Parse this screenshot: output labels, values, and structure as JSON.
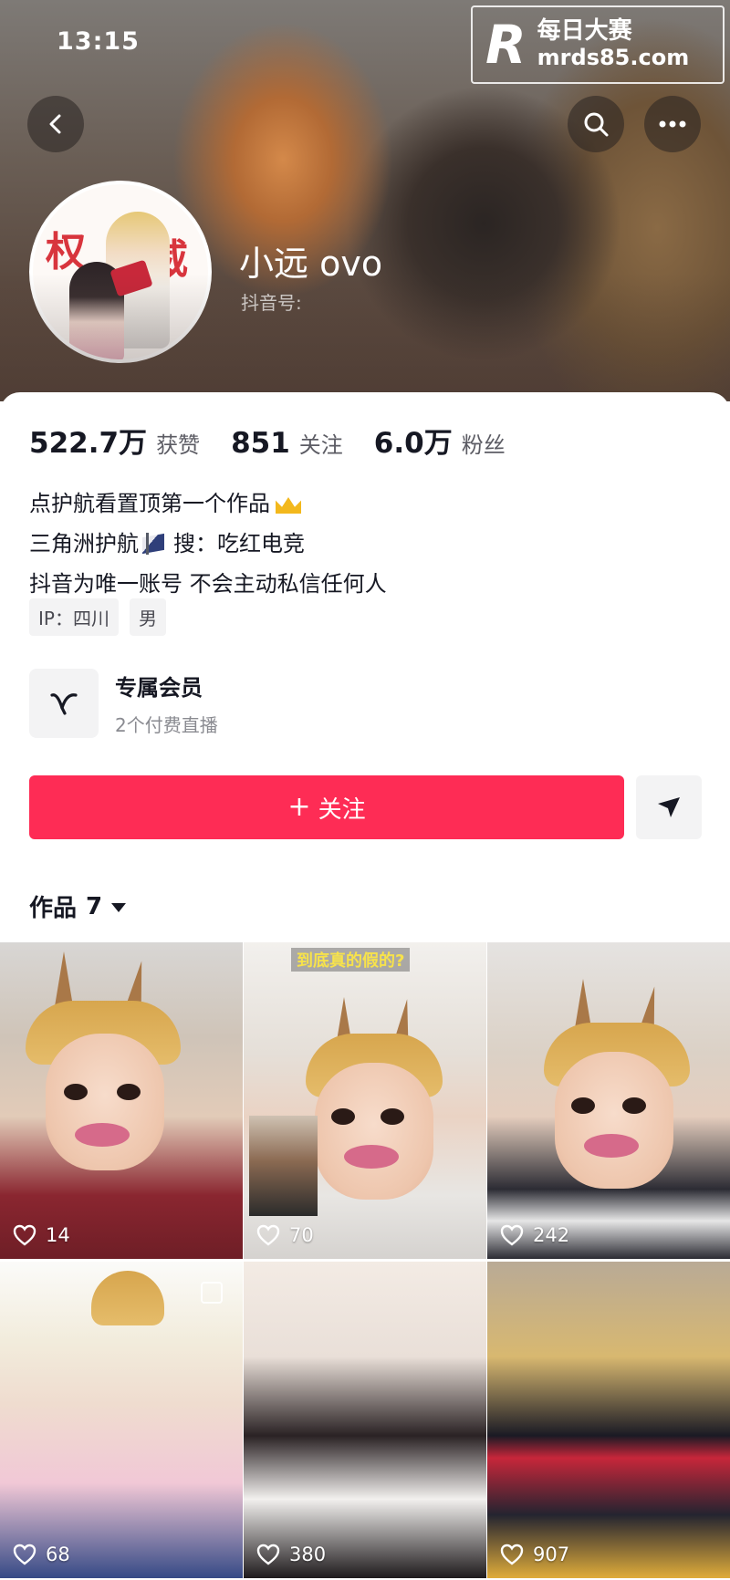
{
  "status_bar": {
    "time": "13:15"
  },
  "watermark": {
    "logo": "R",
    "line1": "每日大赛",
    "line2": "mrds85.com"
  },
  "profile": {
    "nickname": "小远 ovo",
    "douyin_id_label": "抖音号:",
    "stats": [
      {
        "value": "522.7万",
        "label": "获赞"
      },
      {
        "value": "851",
        "label": "关注"
      },
      {
        "value": "6.0万",
        "label": "粉丝"
      }
    ],
    "bio": {
      "line1": "点护航看置顶第一个作品",
      "line2_a": "三角洲护航",
      "line2_b": "搜：吃红电竞",
      "line3": "抖音为唯一账号 不会主动私信任何人"
    },
    "tags": [
      "IP：四川",
      "男"
    ],
    "avatar_text": [
      "权",
      "威"
    ]
  },
  "membership": {
    "title": "专属会员",
    "subtitle": "2个付费直播"
  },
  "actions": {
    "follow_label": "关注",
    "follow_plus": "+"
  },
  "works": {
    "title": "作品",
    "count": "7",
    "videos": [
      {
        "likes": "14"
      },
      {
        "likes": "70",
        "caption": "到底真的假的?"
      },
      {
        "likes": "242"
      },
      {
        "likes": "68"
      },
      {
        "likes": "380"
      },
      {
        "likes": "907"
      }
    ]
  },
  "colors": {
    "accent": "#fe2c55",
    "text": "#161823",
    "secondary": "#5c5c64",
    "tag_bg": "#f3f3f4"
  },
  "icons": [
    "chevron-left-icon",
    "search-icon",
    "more-icon",
    "member-v-icon",
    "share-arrow-icon",
    "heart-icon",
    "crown-icon",
    "flag-icon"
  ]
}
